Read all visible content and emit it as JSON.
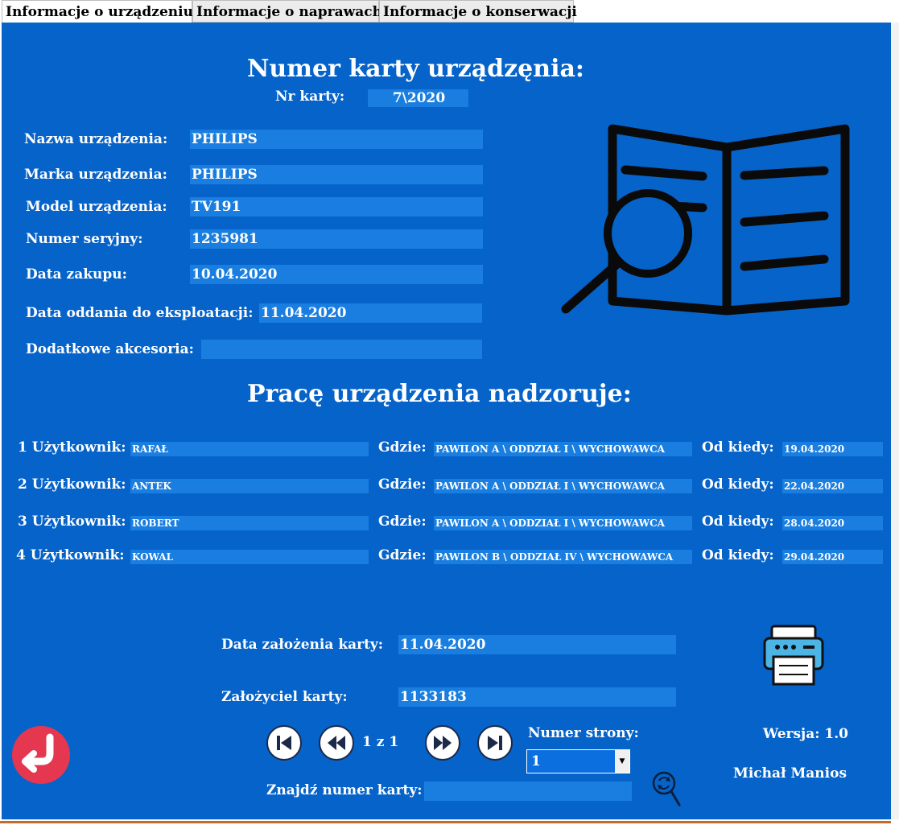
{
  "tabs": [
    {
      "label": "Informacje o urządzeniu"
    },
    {
      "label": "Informacje o naprawach"
    },
    {
      "label": "Informacje o konserwacji"
    }
  ],
  "card": {
    "title": "Numer karty urządzęnia:",
    "nr_label": "Nr karty:",
    "nr_value": "7\\2020"
  },
  "device": {
    "name_label": "Nazwa urządzenia:",
    "name_value": "PHILIPS",
    "brand_label": "Marka urządzenia:",
    "brand_value": "PHILIPS",
    "model_label": "Model urządzenia:",
    "model_value": "TV191",
    "serial_label": "Numer seryjny:",
    "serial_value": "1235981",
    "purchase_label": "Data zakupu:",
    "purchase_value": "10.04.2020",
    "commission_label": "Data oddania do eksploatacji:",
    "commission_value": "11.04.2020",
    "accessories_label": "Dodatkowe akcesoria:",
    "accessories_value": ""
  },
  "supervision": {
    "title": "Pracę urządzenia nadzoruje:",
    "where_label": "Gdzie:",
    "since_label": "Od kiedy:",
    "users": [
      {
        "label": "1 Użytkownik:",
        "name": "RAFAŁ",
        "where": "PAWILON A \\ ODDZIAŁ I \\ WYCHOWAWCA",
        "since": "19.04.2020"
      },
      {
        "label": "2 Użytkownik:",
        "name": "ANTEK",
        "where": "PAWILON A \\ ODDZIAŁ I \\ WYCHOWAWCA",
        "since": "22.04.2020"
      },
      {
        "label": "3 Użytkownik:",
        "name": "ROBERT",
        "where": "PAWILON A \\ ODDZIAŁ I \\ WYCHOWAWCA",
        "since": "28.04.2020"
      },
      {
        "label": "4 Użytkownik:",
        "name": "KOWAL",
        "where": "PAWILON B \\ ODDZIAŁ IV \\ WYCHOWAWCA",
        "since": "29.04.2020"
      }
    ]
  },
  "footer": {
    "created_label": "Data założenia karty:",
    "created_value": "11.04.2020",
    "founder_label": "Założyciel karty:",
    "founder_value": "1133183",
    "page_info": "1 z 1",
    "page_number_label": "Numer strony:",
    "page_number_value": "1",
    "find_label": "Znajdź numer karty:",
    "find_value": "",
    "version": "Wersja: 1.0",
    "author": "Michał Manios"
  },
  "icons": {
    "book": "book-search-icon",
    "printer": "printer-icon",
    "back": "back-arrow-icon",
    "first": "first-page-icon",
    "prev": "previous-page-icon",
    "next": "next-page-icon",
    "last": "last-page-icon",
    "search": "search-refresh-icon"
  },
  "colors": {
    "panel": "#0563c9",
    "field": "#1a7ee0",
    "back_button": "#e5374f"
  }
}
